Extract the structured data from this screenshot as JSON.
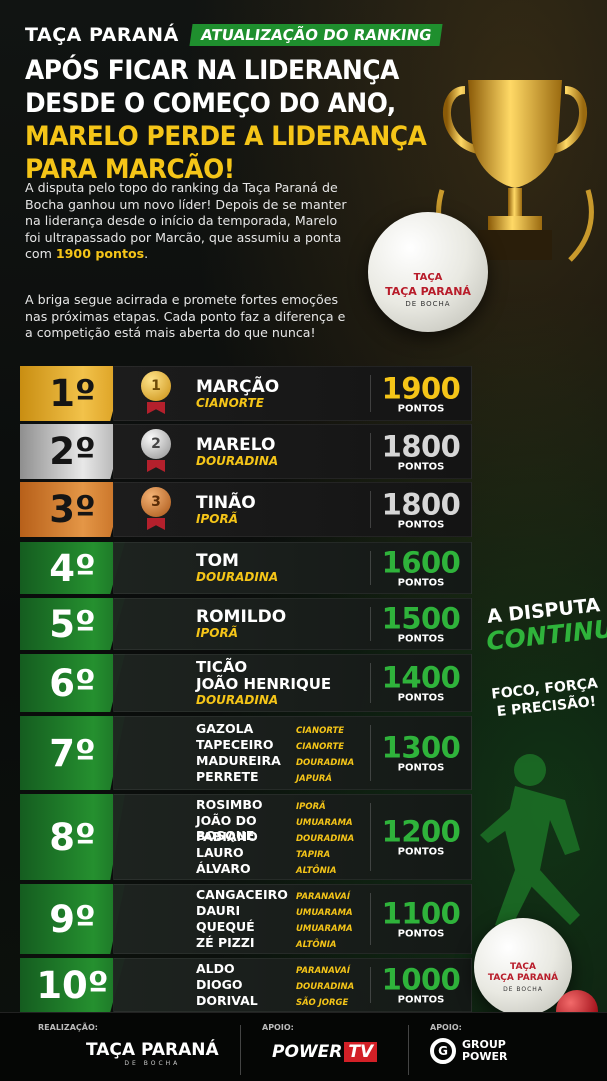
{
  "header": {
    "cup_name": "TAÇA PARANÁ",
    "tag": "ATUALIZAÇÃO DO RANKING"
  },
  "headline": {
    "part1": "APÓS FICAR NA LIDERANÇA DESDE O COMEÇO DO ANO, ",
    "highlight": "MARELO PERDE A LIDERANÇA PARA MARCÃO!"
  },
  "intro": {
    "p1": "A disputa pelo topo do ranking da Taça Paraná de Bocha ganhou um novo líder! Depois de se manter na liderança desde o início da temporada, Marelo foi ultrapassado por Marcão, que assumiu a ponta com ",
    "p1_highlight": "1900 pontos",
    "p1_end": ".",
    "p2": "A briga segue acirrada e promete fortes emoções nas próximas etapas. Cada ponto faz a diferença e a competição está mais aberta do que nunca!"
  },
  "ball_logo": {
    "name1": "TAÇA",
    "name2": "TAÇA PARANÁ",
    "sub": "DE BOCHA"
  },
  "points_unit": "PONTOS",
  "ranking": [
    {
      "rank": "1º",
      "style": "gold",
      "medal": "1",
      "name": "MARÇÃO",
      "city": "CIANORTE",
      "points": "1900"
    },
    {
      "rank": "2º",
      "style": "silver",
      "medal": "2",
      "name": "MARELO",
      "city": "DOURADINA",
      "points": "1800"
    },
    {
      "rank": "3º",
      "style": "bronze",
      "medal": "3",
      "name": "TINÃO",
      "city": "IPORÃ",
      "points": "1800"
    },
    {
      "rank": "4º",
      "style": "green",
      "name": "TOM",
      "city": "DOURADINA",
      "points": "1600"
    },
    {
      "rank": "5º",
      "style": "green",
      "name": "ROMILDO",
      "city": "IPORÃ",
      "points": "1500"
    },
    {
      "rank": "6º",
      "style": "green",
      "name": "TICÃO",
      "name2": "JOÃO HENRIQUE",
      "city": "DOURADINA",
      "points": "1400"
    },
    {
      "rank": "7º",
      "style": "green",
      "points": "1300",
      "players": [
        {
          "name": "GAZOLA",
          "city": "CIANORTE"
        },
        {
          "name": "TAPECEIRO",
          "city": "CIANORTE"
        },
        {
          "name": "MADUREIRA",
          "city": "DOURADINA"
        },
        {
          "name": "PERRETE",
          "city": "JAPURÁ"
        }
      ]
    },
    {
      "rank": "8º",
      "style": "green",
      "points": "1200",
      "players": [
        {
          "name": "ROSIMBO",
          "city": "IPORÃ"
        },
        {
          "name": "JOÃO DO BOSQUE",
          "city": "UMUARAMA"
        },
        {
          "name": "FABIANO",
          "city": "DOURADINA"
        },
        {
          "name": "LAURO",
          "city": "TAPIRA"
        },
        {
          "name": "ÁLVARO",
          "city": "ALTÔNIA"
        }
      ]
    },
    {
      "rank": "9º",
      "style": "green",
      "points": "1100",
      "players": [
        {
          "name": "CANGACEIRO",
          "city": "PARANAVAÍ"
        },
        {
          "name": "DAURI",
          "city": "UMUARAMA"
        },
        {
          "name": "QUEQUÉ",
          "city": "UMUARAMA"
        },
        {
          "name": "ZÉ PIZZI",
          "city": "ALTÔNIA"
        }
      ]
    },
    {
      "rank": "10º",
      "style": "green",
      "points": "1000",
      "players": [
        {
          "name": "ALDO",
          "city": "PARANAVAÍ"
        },
        {
          "name": "DIOGO",
          "city": "DOURADINA"
        },
        {
          "name": "DORIVAL",
          "city": "SÃO JORGE"
        }
      ]
    }
  ],
  "side": {
    "line1": "A DISPUTA",
    "line2": "CONTINUA!",
    "line3": "FOCO, FORÇA",
    "line4": "E PRECISÃO!"
  },
  "footer": {
    "realizacao_label": "REALIZAÇÃO:",
    "realizacao_logo": "TAÇA PARANÁ",
    "realizacao_sub": "DE BOCHA",
    "apoio1_label": "APOIO:",
    "apoio1_a": "POWER",
    "apoio1_b": "TV",
    "apoio2_label": "APOIO:",
    "apoio2_g": "G",
    "apoio2_t1": "GROUP",
    "apoio2_t2": "POWER"
  }
}
